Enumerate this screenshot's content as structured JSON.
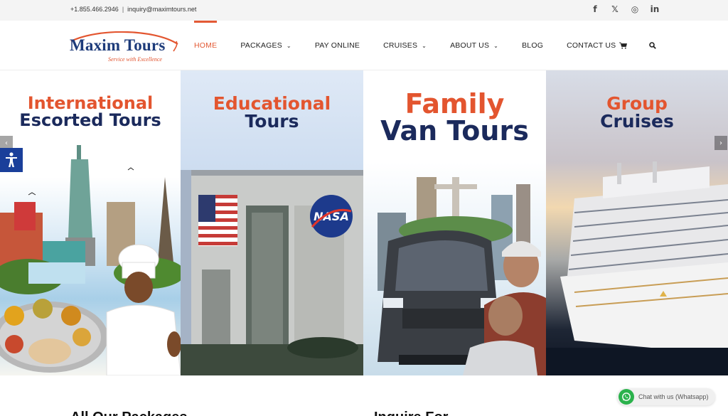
{
  "topbar": {
    "phone": "+1.855.466.2946",
    "separator": "|",
    "email": "inquiry@maximtours.net",
    "social": [
      {
        "name": "facebook-icon",
        "glyph": "f"
      },
      {
        "name": "x-twitter-icon",
        "glyph": "𝕏"
      },
      {
        "name": "instagram-icon",
        "glyph": "◎"
      },
      {
        "name": "linkedin-icon",
        "glyph": "in"
      }
    ]
  },
  "logo": {
    "name": "Maxim Tours",
    "tagline": "Service with Excellence"
  },
  "nav": {
    "home": "HOME",
    "packages": "PACKAGES",
    "pay_online": "PAY ONLINE",
    "cruises": "CRUISES",
    "about_us": "ABOUT US",
    "blog": "BLOG",
    "contact_us": "CONTACT US",
    "cart_icon": "cart-icon",
    "search_icon": "search-icon"
  },
  "banner": {
    "panels": [
      {
        "line1": "International",
        "line2": "Escorted Tours"
      },
      {
        "line1": "Educational",
        "line2": "Tours"
      },
      {
        "line1": "Family",
        "line2": "Van Tours"
      },
      {
        "line1": "Group",
        "line2": "Cruises"
      }
    ],
    "prev_glyph": "‹",
    "next_glyph": "›"
  },
  "below": {
    "heading_left": "All Our Packages",
    "heading_right": "Inquire For"
  },
  "whatsapp": {
    "label": "Chat with us (Whatsapp)"
  },
  "colors": {
    "accent": "#e35a35",
    "brand_navy": "#1b2a5c",
    "whatsapp_green": "#2bb24c",
    "accessibility_blue": "#1a3f9a"
  }
}
